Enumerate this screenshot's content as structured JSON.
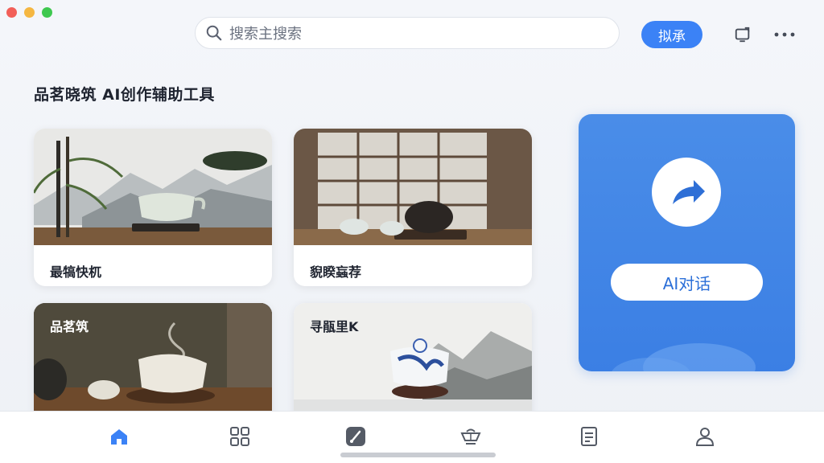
{
  "window": {
    "controls": [
      "close",
      "minimize",
      "maximize"
    ]
  },
  "search": {
    "placeholder": "搜索主搜索",
    "button_label": "拟承",
    "icon": "search-icon"
  },
  "toolbar": {
    "icons": [
      "cast-icon",
      "more-icon"
    ]
  },
  "page": {
    "title": "品茗晓筑 AI创作辅助工具"
  },
  "cards": [
    {
      "label": "最犒快杌",
      "image": "bamboo-teapot-landscape"
    },
    {
      "label": "貎睽蝱荐",
      "image": "japanese-room-teapot"
    },
    {
      "label": "品茗筑",
      "image": "steaming-teapot-dark"
    },
    {
      "label": "寻瓹里K",
      "image": "blue-white-teapot-mountains"
    }
  ],
  "ai_panel": {
    "button_label": "AI对话",
    "icon": "share-arrow-icon"
  },
  "bottom_nav": {
    "items": [
      {
        "name": "home",
        "icon": "home-icon",
        "active": true
      },
      {
        "name": "grid",
        "icon": "grid-icon",
        "active": false
      },
      {
        "name": "brush",
        "icon": "brush-icon",
        "active": false
      },
      {
        "name": "tea",
        "icon": "tea-bowl-icon",
        "active": false
      },
      {
        "name": "notes",
        "icon": "document-icon",
        "active": false
      },
      {
        "name": "profile",
        "icon": "user-icon",
        "active": false
      }
    ]
  },
  "colors": {
    "accent": "#3b82f6",
    "panel": "#4a8de8",
    "text": "#1f2430"
  }
}
